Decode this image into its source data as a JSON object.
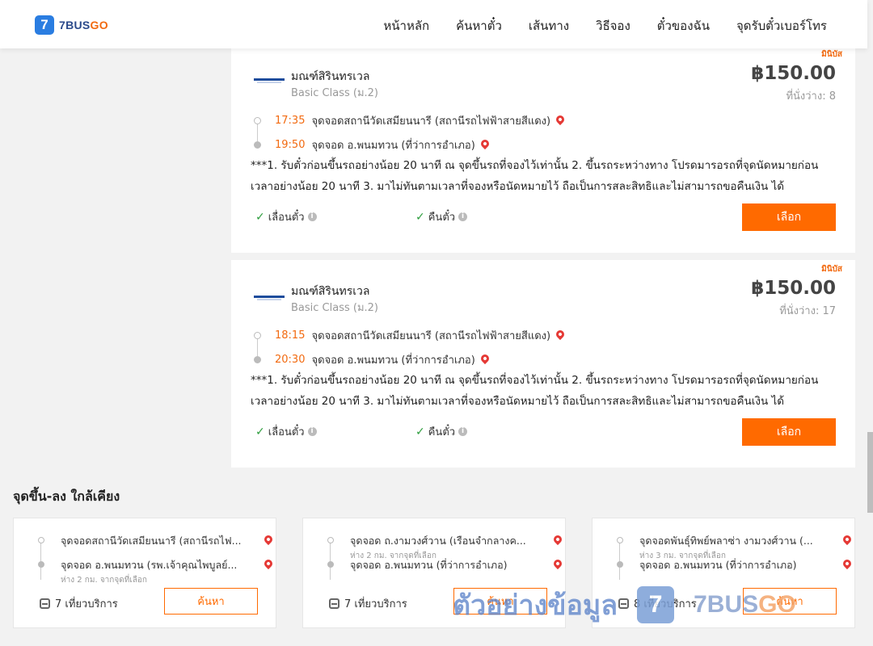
{
  "header": {
    "logo_number": "7",
    "logo_brand": "7BUS",
    "logo_go": "GO",
    "nav": [
      "หน้าหลัก",
      "ค้นหาตั๋ว",
      "เส้นทาง",
      "วิธีจอง",
      "ตั๋วของฉัน",
      "จุดรับตั๋วเบอร์โทร"
    ]
  },
  "trips": [
    {
      "badge": "มินิบัส",
      "operator": "มณฑ์สิรินทรเวล",
      "class": "Basic Class (ม.2)",
      "price": "฿150.00",
      "seats": "ที่นั่งว่าง: 8",
      "depart_time": "17:35",
      "depart_place": "จุดจอดสถานีวัดเสมียนนารี (สถานีรถไฟฟ้าสายสีแดง)",
      "arrive_time": "19:50",
      "arrive_place": "จุดจอด อ.พนมทวน (ที่ว่าการอำเภอ)",
      "note": "***1. รับตั๋วก่อนขึ้นรถอย่างน้อย 20 นาที ณ จุดขึ้นรถที่จองไว้เท่านั้น 2. ขึ้นรถระหว่างทาง โปรดมารอรถที่จุดนัดหมายก่อนเวลาอย่างน้อย 20 นาที 3. มาไม่ทันตามเวลาที่จองหรือนัดหมายไว้ ถือเป็นการสละสิทธิและไม่สามารถขอคืนเงิน ได้",
      "feature_reschedule": "เลื่อนตั๋ว",
      "feature_refund": "คืนตั๋ว",
      "select_label": "เลือก"
    },
    {
      "badge": "มินิบัส",
      "operator": "มณฑ์สิรินทรเวล",
      "class": "Basic Class (ม.2)",
      "price": "฿150.00",
      "seats": "ที่นั่งว่าง: 17",
      "depart_time": "18:15",
      "depart_place": "จุดจอดสถานีวัดเสมียนนารี (สถานีรถไฟฟ้าสายสีแดง)",
      "arrive_time": "20:30",
      "arrive_place": "จุดจอด อ.พนมทวน (ที่ว่าการอำเภอ)",
      "note": "***1. รับตั๋วก่อนขึ้นรถอย่างน้อย 20 นาที ณ จุดขึ้นรถที่จองไว้เท่านั้น 2. ขึ้นรถระหว่างทาง โปรดมารอรถที่จุดนัดหมายก่อนเวลาอย่างน้อย 20 นาที 3. มาไม่ทันตามเวลาที่จองหรือนัดหมายไว้ ถือเป็นการสละสิทธิและไม่สามารถขอคืนเงิน ได้",
      "feature_reschedule": "เลื่อนตั๋ว",
      "feature_refund": "คืนตั๋ว",
      "select_label": "เลือก"
    }
  ],
  "nearby": {
    "title": "จุดขึ้น-ลง ใกล้เคียง",
    "cards": [
      {
        "from": "จุดจอดสถานีวัดเสมียนนารี (สถานีรถไฟ...",
        "from_distance": "",
        "to": "จุดจอด อ.พนมทวน (รพ.เจ้าคุณไพบูลย์...",
        "to_distance": "ห่าง 2 กม. จากจุดที่เลือก",
        "service": "7 เที่ยวบริการ",
        "search_label": "ค้นหา"
      },
      {
        "from": "จุดจอด ถ.งามวงศ์วาน (เรือนจำกลางค...",
        "from_distance": "ห่าง 2 กม. จากจุดที่เลือก",
        "to": "จุดจอด อ.พนมทวน (ที่ว่าการอำเภอ)",
        "to_distance": "",
        "service": "7 เที่ยวบริการ",
        "search_label": "ค้นหา"
      },
      {
        "from": "จุดจอดพันธุ์ทิพย์พลาซ่า งามวงศ์วาน (...",
        "from_distance": "ห่าง 3 กม. จากจุดที่เลือก",
        "to": "จุดจอด อ.พนมทวน (ที่ว่าการอำเภอ)",
        "to_distance": "",
        "service": "8 เที่ยวบริการ",
        "search_label": "ค้นหา"
      }
    ]
  },
  "watermark": {
    "text": "ตัวอย่างข้อมูล",
    "badge": "7",
    "brand": "7BUS",
    "go": "GO"
  },
  "colors": {
    "accent": "#ff6a00",
    "brand_blue": "#2a7de1",
    "pin": "#e53935",
    "check": "#2e9e3e"
  }
}
